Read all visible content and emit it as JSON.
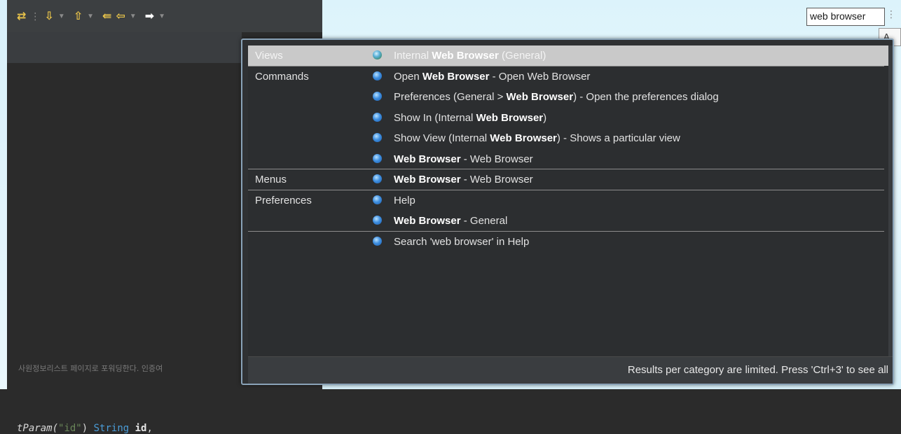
{
  "toolbar": {
    "icons": [
      "step-icon",
      "next-annotation-icon",
      "prev-annotation-icon",
      "back-to-edit-icon",
      "back-icon",
      "forward-icon"
    ]
  },
  "search": {
    "value": "web browser",
    "tooltip_fragment": "A"
  },
  "editor": {
    "comment_korean": "사원정보리스트 페이지로 포워딩한다. 인증여",
    "code": {
      "fn_fragment": "tParam(",
      "str": "\"id\"",
      "close": ")",
      "type": "String",
      "ident": "id",
      "comma": ","
    }
  },
  "popup": {
    "rows": [
      {
        "category": "Views",
        "pre": "Internal ",
        "bold": "Web Browser",
        "post": " (General)",
        "selected": true
      },
      {
        "category": "Commands",
        "pre": "Open ",
        "bold": "Web Browser",
        "post": " - Open Web Browser"
      },
      {
        "category": "",
        "pre": "Preferences (General > ",
        "bold": "Web Browser",
        "post": ") - Open the preferences dialog"
      },
      {
        "category": "",
        "pre": "Show In (Internal ",
        "bold": "Web Browser",
        "post": ")"
      },
      {
        "category": "",
        "pre": "Show View (Internal ",
        "bold": "Web Browser",
        "post": ") - Shows a particular view"
      },
      {
        "category": "",
        "pre": "",
        "bold": "Web Browser",
        "post": " - Web Browser"
      },
      {
        "category": "Menus",
        "pre": "",
        "bold": "Web Browser",
        "post": " - Web Browser"
      },
      {
        "category": "Preferences",
        "pre": "Help",
        "bold": "",
        "post": ""
      },
      {
        "category": "",
        "pre": "",
        "bold": "Web Browser",
        "post": " - General"
      },
      {
        "category": "",
        "pre": "Search 'web browser' in Help",
        "bold": "",
        "post": ""
      }
    ],
    "footer": "Results per category are limited. Press 'Ctrl+3' to see all"
  },
  "colors": {
    "accent_dot": "#3f8fe0",
    "selected_row": "#c9c9c9",
    "popup_border": "#8aa3b8"
  }
}
